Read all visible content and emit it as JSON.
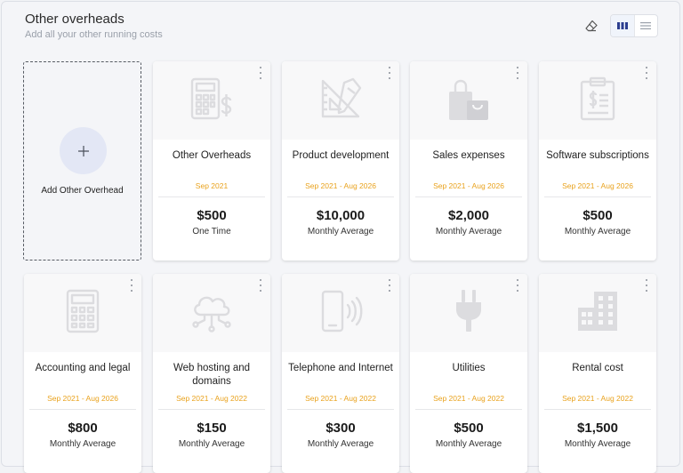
{
  "header": {
    "title": "Other overheads",
    "subtitle": "Add all your other running costs"
  },
  "toolbar": {
    "eraser_icon": "eraser-icon",
    "grid_view_icon": "grid-view-icon",
    "list_view_icon": "list-view-icon",
    "active_view": "grid"
  },
  "add_card": {
    "label": "Add Other Overhead",
    "icon": "plus-icon"
  },
  "colors": {
    "accent": "#2c3e8f",
    "date_color": "#e9a21d",
    "icon_color": "#dcdcdf"
  },
  "cards": [
    {
      "name": "Other Overheads",
      "date": "Sep 2021",
      "amount": "$500",
      "freq": "One Time",
      "icon": "calculator-dollar-icon"
    },
    {
      "name": "Product development",
      "date": "Sep 2021 - Aug 2026",
      "amount": "$10,000",
      "freq": "Monthly Average",
      "icon": "ruler-pencil-icon"
    },
    {
      "name": "Sales expenses",
      "date": "Sep 2021 - Aug 2026",
      "amount": "$2,000",
      "freq": "Monthly Average",
      "icon": "shopping-bags-icon"
    },
    {
      "name": "Software subscriptions",
      "date": "Sep 2021 - Aug 2026",
      "amount": "$500",
      "freq": "Monthly Average",
      "icon": "clipboard-dollar-icon"
    },
    {
      "name": "Accounting and legal",
      "date": "Sep 2021 - Aug 2026",
      "amount": "$800",
      "freq": "Monthly Average",
      "icon": "calculator-icon"
    },
    {
      "name": "Web hosting and domains",
      "date": "Sep 2021 - Aug 2022",
      "amount": "$150",
      "freq": "Monthly Average",
      "icon": "cloud-network-icon"
    },
    {
      "name": "Telephone and Internet",
      "date": "Sep 2021 - Aug 2022",
      "amount": "$300",
      "freq": "Monthly Average",
      "icon": "phone-signal-icon"
    },
    {
      "name": "Utilities",
      "date": "Sep 2021 - Aug 2022",
      "amount": "$500",
      "freq": "Monthly Average",
      "icon": "power-plug-icon"
    },
    {
      "name": "Rental cost",
      "date": "Sep 2021 - Aug 2022",
      "amount": "$1,500",
      "freq": "Monthly Average",
      "icon": "buildings-icon"
    }
  ]
}
